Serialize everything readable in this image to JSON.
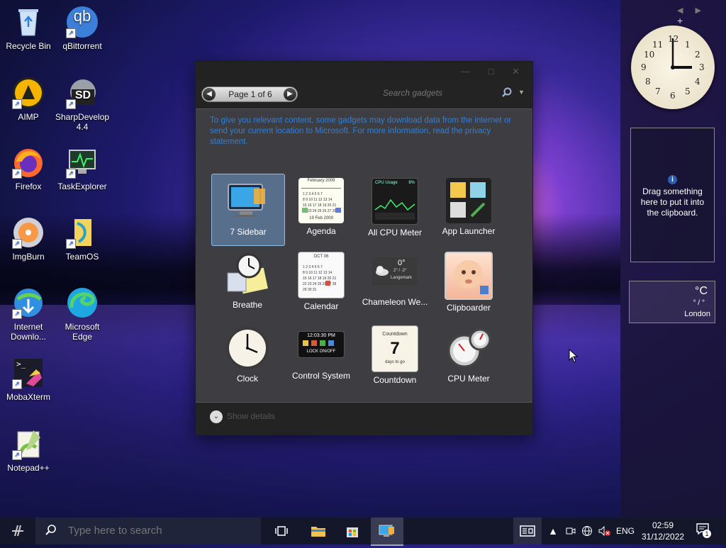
{
  "desktop": {
    "icons": [
      {
        "label": "Recycle Bin"
      },
      {
        "label": "qBittorrent"
      },
      {
        "label": "AIMP"
      },
      {
        "label": "SharpDevelop 4.4"
      },
      {
        "label": "Firefox"
      },
      {
        "label": "TaskExplorer"
      },
      {
        "label": "ImgBurn"
      },
      {
        "label": "TeamOS"
      },
      {
        "label": "Internet Downlo..."
      },
      {
        "label": "Microsoft Edge"
      },
      {
        "label": "MobaXterm"
      },
      {
        "label": "Notepad++"
      }
    ],
    "logo_texts": {
      "qbittorrent": "qb",
      "sharpdevelop": "SD",
      "mobaxterm": ">_"
    }
  },
  "gadget_window": {
    "pager": {
      "label": "Page 1 of 6",
      "prev": "◀",
      "next": "▶"
    },
    "search": {
      "placeholder": "Search gadgets"
    },
    "privacy_note": "To give you relevant content, some gadgets may download data from the internet or send your current location to Microsoft. For more information, read the privacy statement.",
    "gadgets": [
      {
        "label": "7 Sidebar"
      },
      {
        "label": "Agenda"
      },
      {
        "label": "All CPU Meter"
      },
      {
        "label": "App Launcher"
      },
      {
        "label": "Breathe"
      },
      {
        "label": "Calendar"
      },
      {
        "label": "Chameleon We..."
      },
      {
        "label": "Clipboarder"
      },
      {
        "label": "Clock"
      },
      {
        "label": "Control System"
      },
      {
        "label": "Countdown"
      },
      {
        "label": "CPU Meter"
      }
    ],
    "thumb_texts": {
      "agenda_month": "February 2009",
      "agenda_footer": "19 Feb 2009",
      "cpu_header": "CPU Usage",
      "cpu_value": "8%",
      "calendar_month": "OCT 06",
      "chameleon_temp": "0°",
      "chameleon_range": "2° / -2°",
      "chameleon_place": "Langemark",
      "control_time": "12:03:30 PM",
      "control_lock": "LOCK ON/OFF",
      "countdown_title": "Countdown",
      "countdown_days": "7",
      "countdown_footer": "days to go"
    },
    "details_label": "Show details"
  },
  "sidebar": {
    "controls": {
      "prev": "◀",
      "next": "▶",
      "add": "+"
    },
    "clipboard_message": "Drag something here to put it into the clipboard.",
    "weather": {
      "unit": "°C",
      "range": "° / °",
      "city": "London"
    },
    "clock_numbers": [
      "12",
      "1",
      "2",
      "3",
      "4",
      "5",
      "6",
      "7",
      "8",
      "9",
      "10",
      "11"
    ]
  },
  "taskbar": {
    "search_placeholder": "Type here to search",
    "language": "ENG",
    "time": "02:59",
    "date": "31/12/2022",
    "notification_count": "1"
  },
  "colors": {
    "accent": "#2f7fd9",
    "selection": "#78aae6"
  }
}
